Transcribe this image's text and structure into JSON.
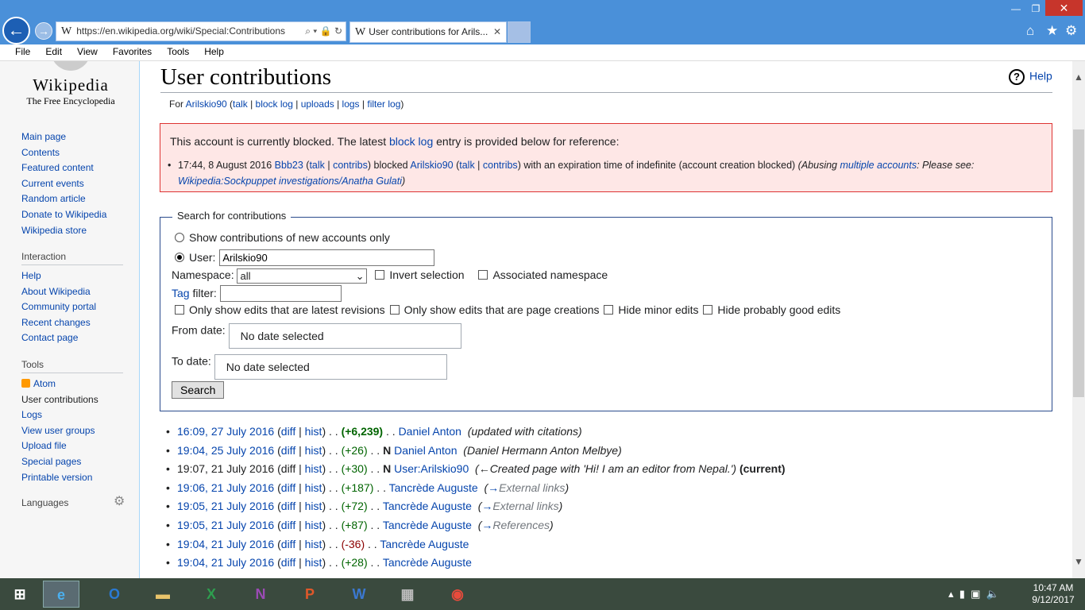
{
  "browser": {
    "address_url": "https://en.wikipedia.org/wiki/Special:Contributions",
    "tab_title": "User contributions for Arils...",
    "menu": [
      "File",
      "Edit",
      "View",
      "Favorites",
      "Tools",
      "Help"
    ]
  },
  "sidebar": {
    "logo_title": "Wikipedia",
    "logo_tagline": "The Free Encyclopedia",
    "nav": [
      "Main page",
      "Contents",
      "Featured content",
      "Current events",
      "Random article",
      "Donate to Wikipedia",
      "Wikipedia store"
    ],
    "interaction_heading": "Interaction",
    "interaction": [
      "Help",
      "About Wikipedia",
      "Community portal",
      "Recent changes",
      "Contact page"
    ],
    "tools_heading": "Tools",
    "tools": [
      "Atom",
      "User contributions",
      "Logs",
      "View user groups",
      "Upload file",
      "Special pages",
      "Printable version"
    ],
    "languages_heading": "Languages"
  },
  "page": {
    "title": "User contributions",
    "help": "Help",
    "sub_for": "For",
    "sub_user": "Arilskio90",
    "sub_links": [
      "talk",
      "block log",
      "uploads",
      "logs",
      "filter log"
    ]
  },
  "block": {
    "p1_a": "This account is currently blocked. The latest",
    "p1_link": "block log",
    "p1_b": "entry is provided below for reference:",
    "time": "17:44, 8 August 2016",
    "admin": "Bbb23",
    "talk": "talk",
    "contribs": "contribs",
    "blocked": "blocked",
    "user": "Arilskio90",
    "expiry": "with an expiration time of indefinite (account creation blocked)",
    "reason_a": "(Abusing",
    "reason_link": "multiple accounts",
    "reason_b": ": Please see:",
    "reason_link2": "Wikipedia:Sockpuppet investigations/Anatha Gulati",
    "reason_c": ")"
  },
  "form": {
    "legend": "Search for contributions",
    "new_accounts": "Show contributions of new accounts only",
    "user_label": "User:",
    "user_value": "Arilskio90",
    "namespace_label": "Namespace:",
    "namespace_value": "all",
    "invert": "Invert selection",
    "associated": "Associated namespace",
    "tag_link": "Tag",
    "tag_label": "filter:",
    "latest": "Only show edits that are latest revisions",
    "creations": "Only show edits that are page creations",
    "minor": "Hide minor edits",
    "good": "Hide probably good edits",
    "from_label": "From date:",
    "from_value": "No date selected",
    "to_label": "To date:",
    "to_value": "No date selected",
    "search": "Search"
  },
  "contribs": [
    {
      "date": "16:09, 27 July 2016",
      "diff": "diff",
      "hist": "hist",
      "size": "(+6,239)",
      "page": "Daniel Anton",
      "comment": "(updated with citations)",
      "new": ""
    },
    {
      "date": "19:04, 25 July 2016",
      "diff": "diff",
      "hist": "hist",
      "size": "(+26)",
      "page": "Daniel Anton",
      "comment": "(Daniel Hermann Anton Melbye)",
      "new": "N"
    },
    {
      "date": "19:07, 21 July 2016",
      "diff": "diff",
      "hist": "hist",
      "size": "(+30)",
      "page": "User:Arilskio90",
      "comment": "(←Created page with 'Hi! I am an editor from Nepal.')",
      "new": "N",
      "current": "(current)"
    },
    {
      "date": "19:06, 21 July 2016",
      "diff": "diff",
      "hist": "hist",
      "size": "(+187)",
      "page": "Tancrède Auguste",
      "comment": "(→External links)"
    },
    {
      "date": "19:05, 21 July 2016",
      "diff": "diff",
      "hist": "hist",
      "size": "(+72)",
      "page": "Tancrède Auguste",
      "comment": "(→External links)"
    },
    {
      "date": "19:05, 21 July 2016",
      "diff": "diff",
      "hist": "hist",
      "size": "(+87)",
      "page": "Tancrède Auguste",
      "comment": "(→References)"
    },
    {
      "date": "19:04, 21 July 2016",
      "diff": "diff",
      "hist": "hist",
      "size": "(-36)",
      "page": "Tancrède Auguste",
      "comment": ""
    },
    {
      "date": "19:04, 21 July 2016",
      "diff": "diff",
      "hist": "hist",
      "size": "(+28)",
      "page": "Tancrède Auguste",
      "comment": ""
    }
  ],
  "taskbar": {
    "time": "10:47 AM",
    "date": "9/12/2017"
  }
}
